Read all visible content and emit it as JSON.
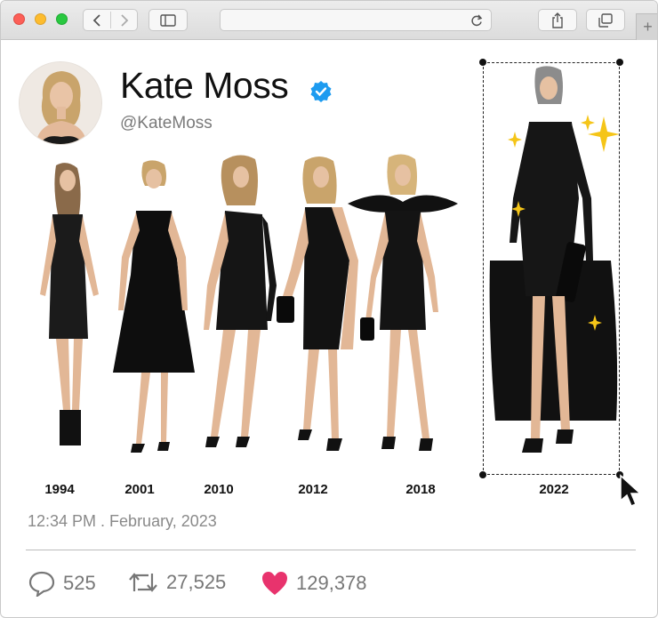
{
  "browser": {
    "address": "",
    "icons": {
      "back": "chevron-left-icon",
      "forward": "chevron-right-icon",
      "sidebar": "sidebar-icon",
      "reload": "reload-icon",
      "share": "share-icon",
      "tabs": "tabs-icon",
      "new_tab": "plus-icon"
    },
    "new_tab_label": "+"
  },
  "tweet": {
    "name": "Kate Moss",
    "handle": "@KateMoss",
    "verified": true,
    "timestamp": "12:34 PM . February, 2023",
    "stats": {
      "replies": "525",
      "retweets": "27,525",
      "likes": "129,378"
    },
    "colors": {
      "verified": "#1d9bf0",
      "like": "#e8336d"
    }
  },
  "looks": [
    {
      "year": "1994"
    },
    {
      "year": "2001"
    },
    {
      "year": "2010"
    },
    {
      "year": "2012"
    },
    {
      "year": "2018"
    },
    {
      "year": "2022"
    }
  ]
}
